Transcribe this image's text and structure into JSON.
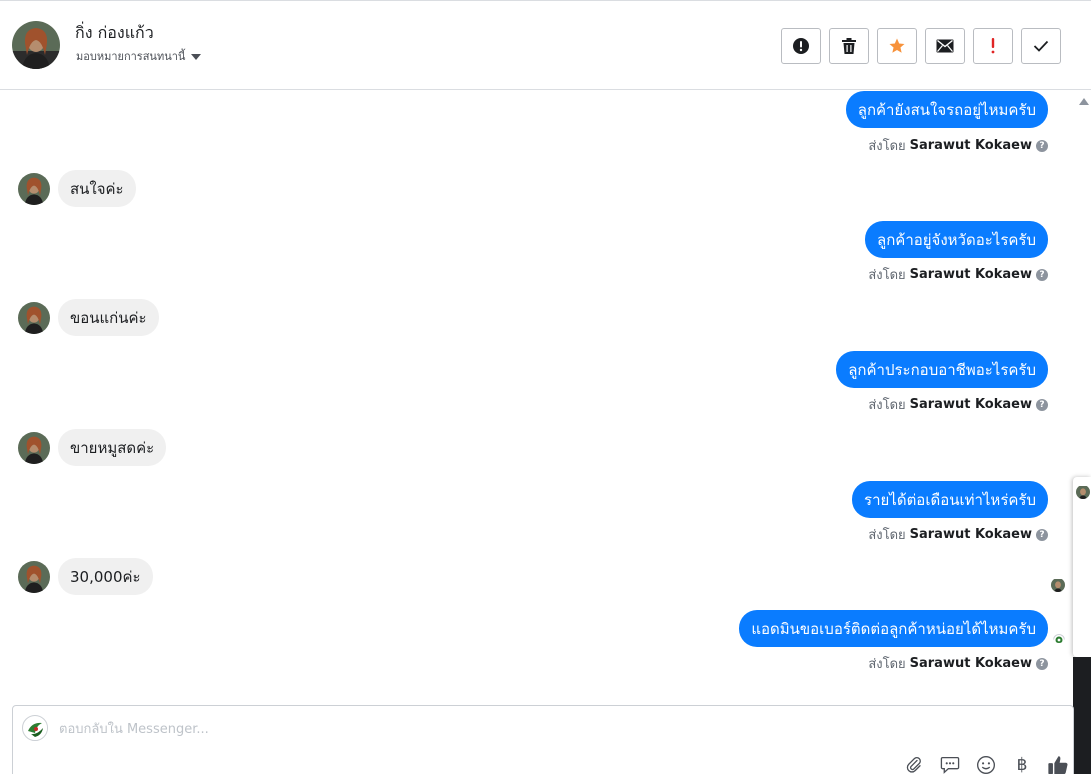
{
  "header": {
    "contact_name": "กิ่ง ก่องแก้ว",
    "assign_label": "มอบหมายการสนทนานี้",
    "actions": [
      {
        "name": "mark-spam",
        "icon": "alert-circle-icon"
      },
      {
        "name": "delete",
        "icon": "trash-icon"
      },
      {
        "name": "star",
        "icon": "star-icon",
        "color": "#f7923b"
      },
      {
        "name": "mark-unread",
        "icon": "envelope-icon"
      },
      {
        "name": "follow-up",
        "icon": "exclamation-icon",
        "color": "#e02424"
      },
      {
        "name": "mark-done",
        "icon": "check-icon"
      }
    ]
  },
  "thread": {
    "sent_by_prefix": "ส่งโดย",
    "agent_name": "Sarawut Kokaew",
    "outgoing": [
      {
        "text": "ลูกค้ายังสนใจรถอยู่ไหมครับ"
      },
      {
        "text": "ลูกค้าอยู่จังหวัดอะไรครับ"
      },
      {
        "text": "ลูกค้าประกอบอาชีพอะไรครับ"
      },
      {
        "text": "รายได้ต่อเดือนเท่าไหร่ครับ"
      },
      {
        "text": "แอดมินขอเบอร์ติดต่อลูกค้าหน่อยได้ไหมครับ"
      }
    ],
    "incoming": [
      {
        "text": "สนใจค่ะ"
      },
      {
        "text": "ขอนแก่นค่ะ"
      },
      {
        "text": "ขายหมูสดค่ะ"
      },
      {
        "text": "30,000ค่ะ"
      }
    ]
  },
  "composer": {
    "placeholder": "ตอบกลับใน Messenger...",
    "tools": [
      "paperclip-icon",
      "speech-bubble-icon",
      "smiley-icon",
      "baht-icon",
      "thumbs-up-icon"
    ],
    "baht_glyph": "฿"
  },
  "colors": {
    "outgoing_bubble": "#0a7cff",
    "incoming_bubble": "#f0f0f0",
    "star": "#f7923b",
    "alert": "#e02424"
  }
}
